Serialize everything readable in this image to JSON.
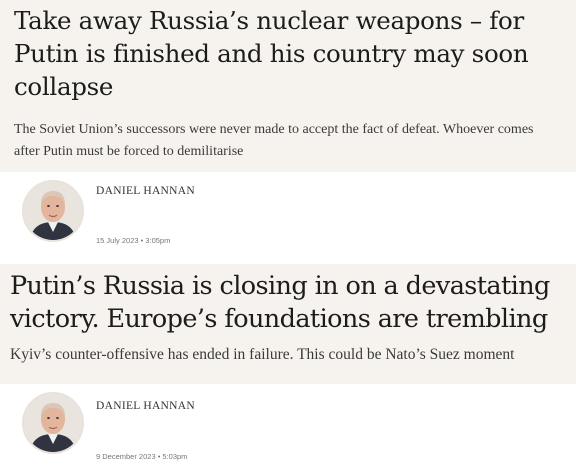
{
  "articles": [
    {
      "headline": "Take away Russia’s nuclear weapons – for Putin is finished and his country may soon collapse",
      "standfirst": "The Soviet Union’s successors were never made to accept the fact of defeat. Whoever comes after Putin must be forced to demilitarise",
      "author": "DANIEL HANNAN",
      "timestamp": "15 July 2023 • 3:05pm"
    },
    {
      "headline": "Putin’s Russia is closing in on a devastating victory. Europe’s foundations are trembling",
      "standfirst": "Kyiv’s counter-offensive has ended in failure. This could be Nato’s Suez moment",
      "author": "DANIEL HANNAN",
      "timestamp": "9 December 2023 • 5:03pm"
    }
  ],
  "colors": {
    "card_background": "#f6f2ed",
    "headline": "#1c1c1c",
    "standfirst": "#3a3a3a"
  }
}
